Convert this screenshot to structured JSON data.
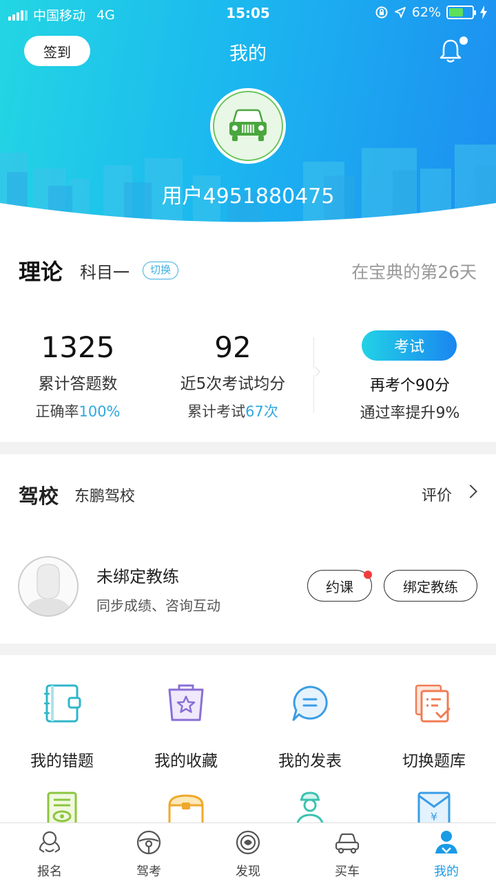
{
  "status_bar": {
    "carrier": "中国移动",
    "network": "4G",
    "time": "15:05",
    "battery": "62%",
    "battery_level": 0.62
  },
  "header": {
    "checkin_label": "签到",
    "title": "我的",
    "username": "用户4951880475"
  },
  "theory": {
    "title": "理论",
    "subject": "科目一",
    "switch_label": "切换",
    "days_text": "在宝典的第26天",
    "answered_count": "1325",
    "answered_label": "累计答题数",
    "accuracy_prefix": "正确率",
    "accuracy_value": "100%",
    "avg_score": "92",
    "avg_label": "近5次考试均分",
    "exams_prefix": "累计考试",
    "exams_value": "67次",
    "exam_button": "考试",
    "retake_text": "再考个90分",
    "pass_text": "通过率提升9%"
  },
  "school": {
    "title": "驾校",
    "name": "东鹏驾校",
    "rate_label": "评价",
    "coach_status": "未绑定教练",
    "coach_desc": "同步成绩、咨询互动",
    "book_label": "约课",
    "bind_label": "绑定教练"
  },
  "grid": {
    "items": [
      {
        "label": "我的错题",
        "icon": "notebook-icon"
      },
      {
        "label": "我的收藏",
        "icon": "star-bag-icon"
      },
      {
        "label": "我的发表",
        "icon": "chat-bubble-icon"
      },
      {
        "label": "切换题库",
        "icon": "question-bank-icon"
      }
    ]
  },
  "tabbar": {
    "tabs": [
      {
        "label": "报名",
        "icon": "signup-icon"
      },
      {
        "label": "驾考",
        "icon": "steering-wheel-icon"
      },
      {
        "label": "发现",
        "icon": "discover-icon"
      },
      {
        "label": "买车",
        "icon": "car-icon"
      },
      {
        "label": "我的",
        "icon": "profile-icon",
        "active": true
      }
    ]
  },
  "colors": {
    "accent": "#1a9be6",
    "highlight": "#2fa8de",
    "header_start": "#23d6e3",
    "header_end": "#1d8ef1",
    "notify": "#f23c3c"
  }
}
